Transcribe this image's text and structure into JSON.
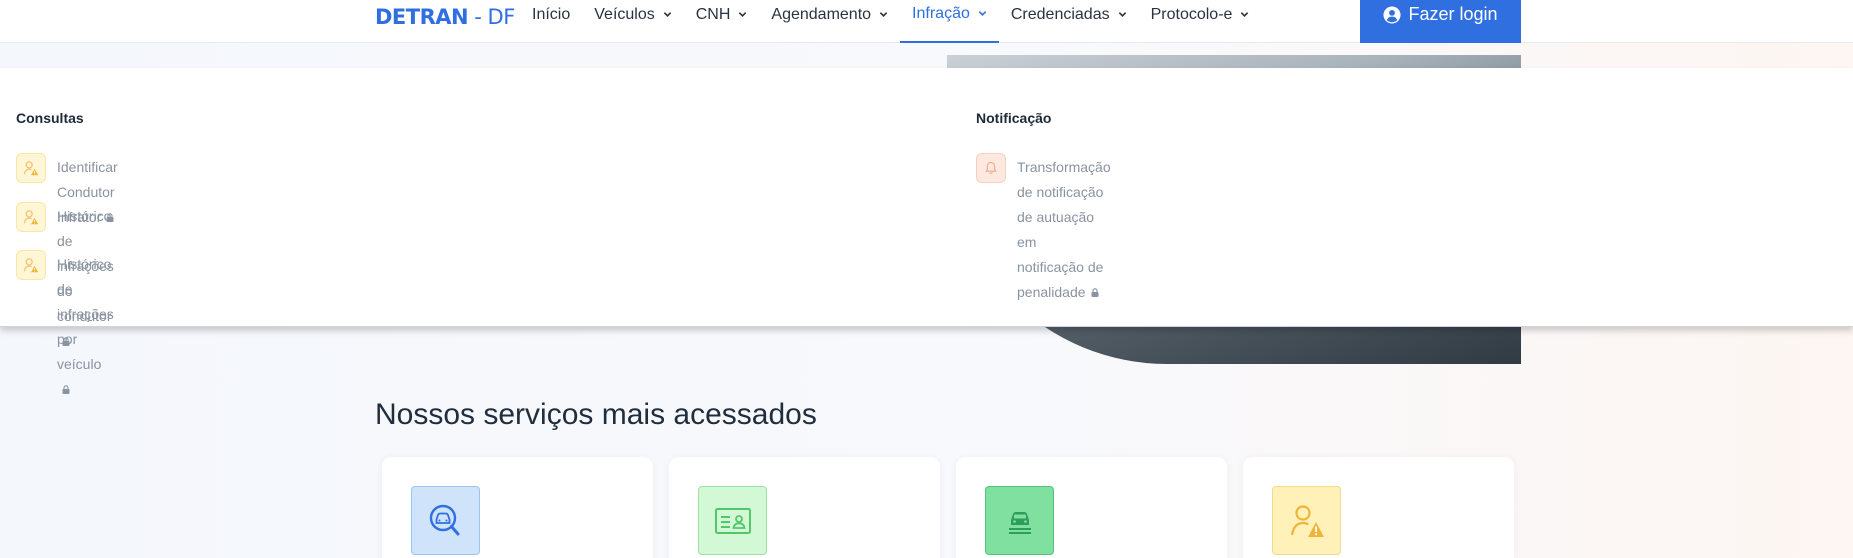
{
  "header": {
    "logo": {
      "strong": "DETRAN",
      "light": " - DF"
    },
    "nav": [
      {
        "label": "Início",
        "has_dropdown": false
      },
      {
        "label": "Veículos",
        "has_dropdown": true
      },
      {
        "label": "CNH",
        "has_dropdown": true
      },
      {
        "label": "Agendamento",
        "has_dropdown": true
      },
      {
        "label": "Infração",
        "has_dropdown": true,
        "active": true
      },
      {
        "label": "Credenciadas",
        "has_dropdown": true
      },
      {
        "label": "Protocolo-e",
        "has_dropdown": true
      }
    ],
    "login_label": "Fazer login"
  },
  "mega_menu": {
    "columns": [
      {
        "title": "Consultas",
        "items": [
          {
            "label": "Identificar Condutor Infrator",
            "icon": "user-warning-icon",
            "locked": true
          },
          {
            "label": "Histórico de infrações do condutor",
            "icon": "user-warning-icon",
            "locked": true
          },
          {
            "label": "Histórico de infrações por veículo",
            "icon": "user-warning-icon",
            "locked": true
          }
        ]
      },
      {
        "title": "Notificação",
        "items": [
          {
            "label_line1": "Transformação de notificação de autuação em",
            "label_line2": "notificação de penalidade",
            "icon": "bell-icon",
            "locked": true
          }
        ]
      }
    ]
  },
  "services": {
    "title": "Nossos serviços mais acessados",
    "cards": [
      {
        "icon": "car-search-icon",
        "color": "#cfe3fb"
      },
      {
        "icon": "id-card-icon",
        "color": "#d3f8d6"
      },
      {
        "icon": "car-document-icon",
        "color": "#7fe0a0"
      },
      {
        "icon": "user-warning-icon",
        "color": "#fff1b8"
      }
    ]
  },
  "colors": {
    "accent": "#2f6fe0",
    "muted_text": "#8a93a0"
  }
}
